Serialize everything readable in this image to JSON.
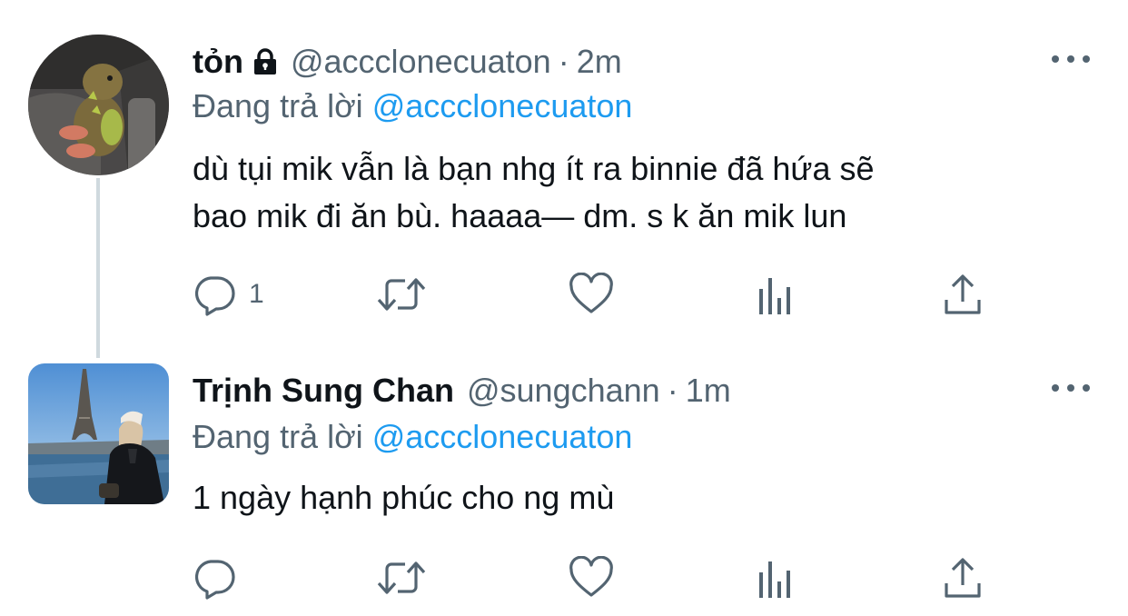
{
  "tweets": [
    {
      "name": "tỏn",
      "protected": true,
      "handle": "@accclonecuaton",
      "separator": "·",
      "time": "2m",
      "reply_prefix": "Đang trả lời",
      "reply_to": "@accclonecuaton",
      "text_lines": [
        "dù tụi mik vẫn là bạn nhg ít ra binnie đã hứa sẽ",
        "bao mik đi ăn bù. haaaa— dm. s k ăn mik lun"
      ],
      "reply_count": "1",
      "avatar": "avatar-plush-dinosaur"
    },
    {
      "name": "Trịnh Sung Chan",
      "protected": false,
      "handle": "@sungchann",
      "separator": "·",
      "time": "1m",
      "reply_prefix": "Đang trả lời",
      "reply_to": "@accclonecuaton",
      "text_lines": [
        "1 ngày hạnh phúc cho ng mù"
      ],
      "reply_count": "",
      "avatar": "avatar-eiffel-tower-photo"
    }
  ],
  "icons": {
    "more": "more-icon",
    "lock": "lock-icon",
    "reply": "reply-icon",
    "retweet": "retweet-icon",
    "like": "heart-icon",
    "views": "views-icon",
    "share": "share-icon"
  },
  "colors": {
    "text": "#0f1419",
    "secondary": "#536471",
    "link": "#1d9bf0",
    "thread_line": "#cfd9de"
  }
}
